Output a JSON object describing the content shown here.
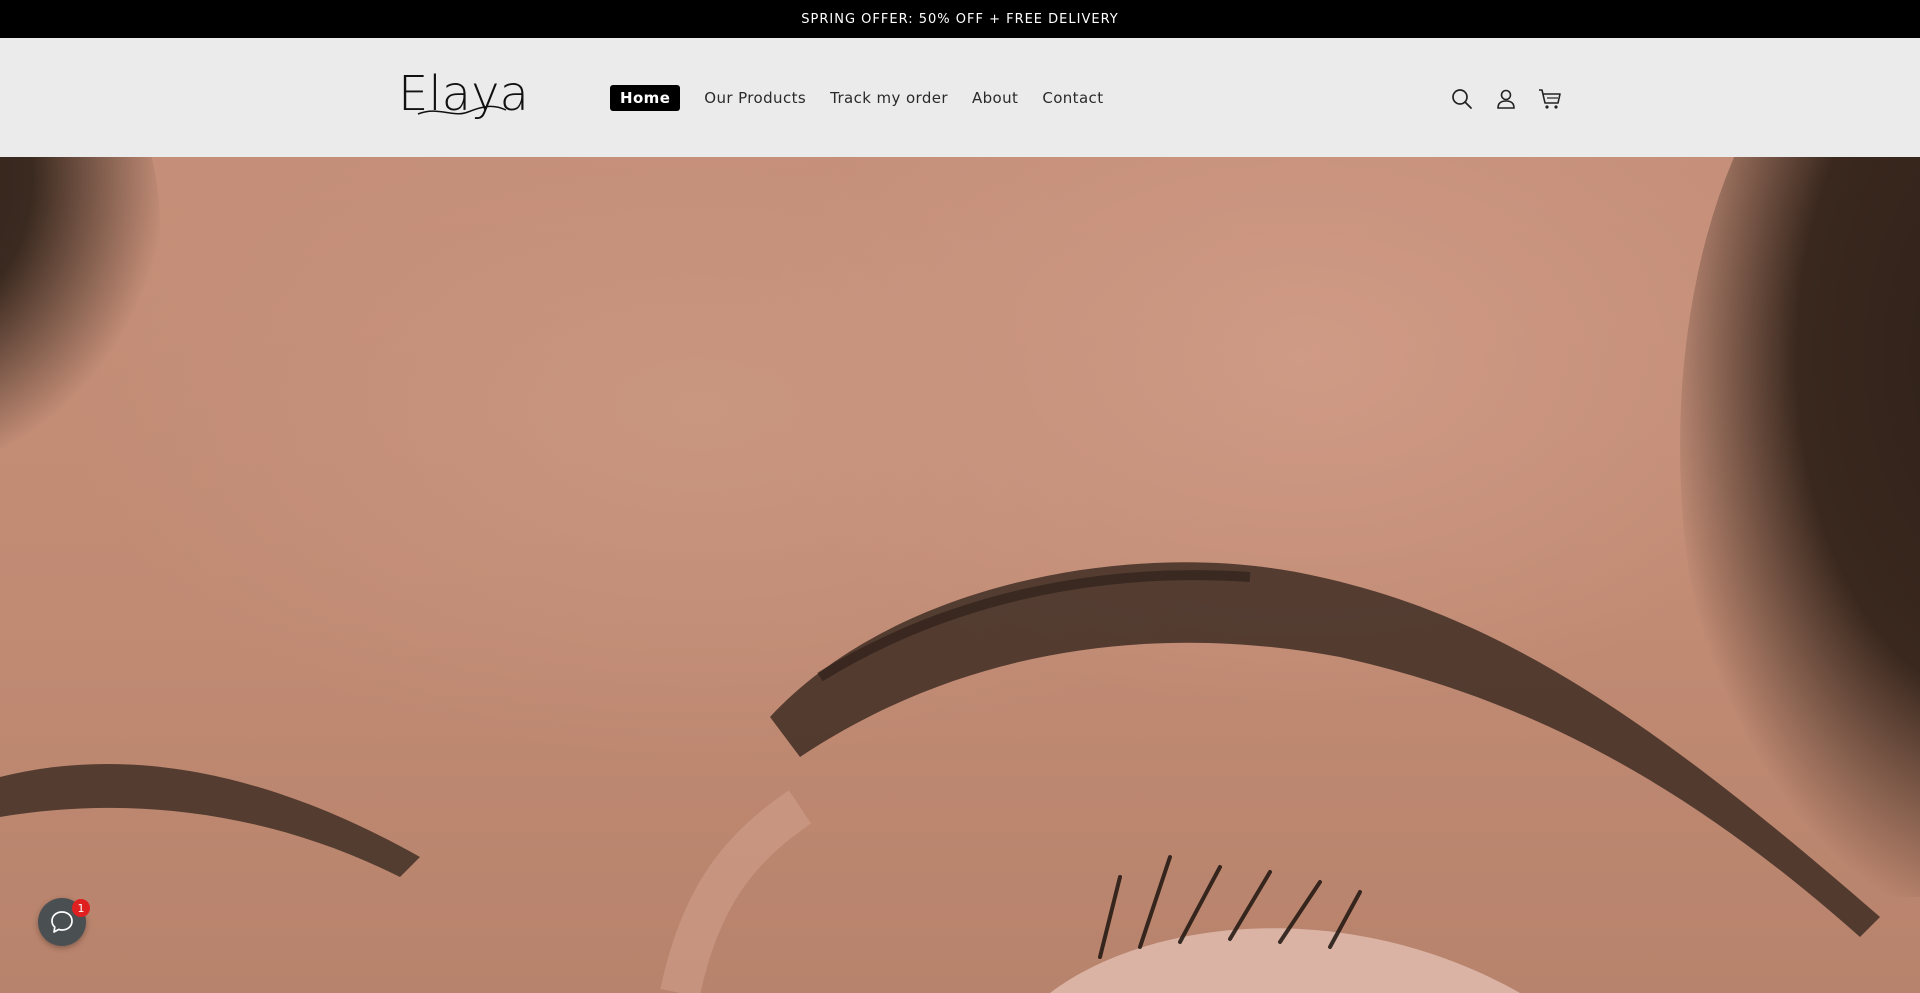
{
  "announcement": {
    "text": "SPRING OFFER: 50% OFF + FREE DELIVERY"
  },
  "header": {
    "logo_text": "Elaya",
    "nav": [
      {
        "label": "Home",
        "active": true
      },
      {
        "label": "Our Products",
        "active": false
      },
      {
        "label": "Track my order",
        "active": false
      },
      {
        "label": "About",
        "active": false
      },
      {
        "label": "Contact",
        "active": false
      }
    ],
    "icons": [
      "search-icon",
      "account-icon",
      "cart-icon"
    ]
  },
  "hero": {
    "image": "close-up of eye and eyebrow"
  },
  "chat": {
    "badge_count": "1"
  },
  "colors": {
    "announcement_bg": "#000000",
    "header_bg": "#ebebeb",
    "nav_active_bg": "#000000",
    "chat_badge": "#e02020"
  }
}
